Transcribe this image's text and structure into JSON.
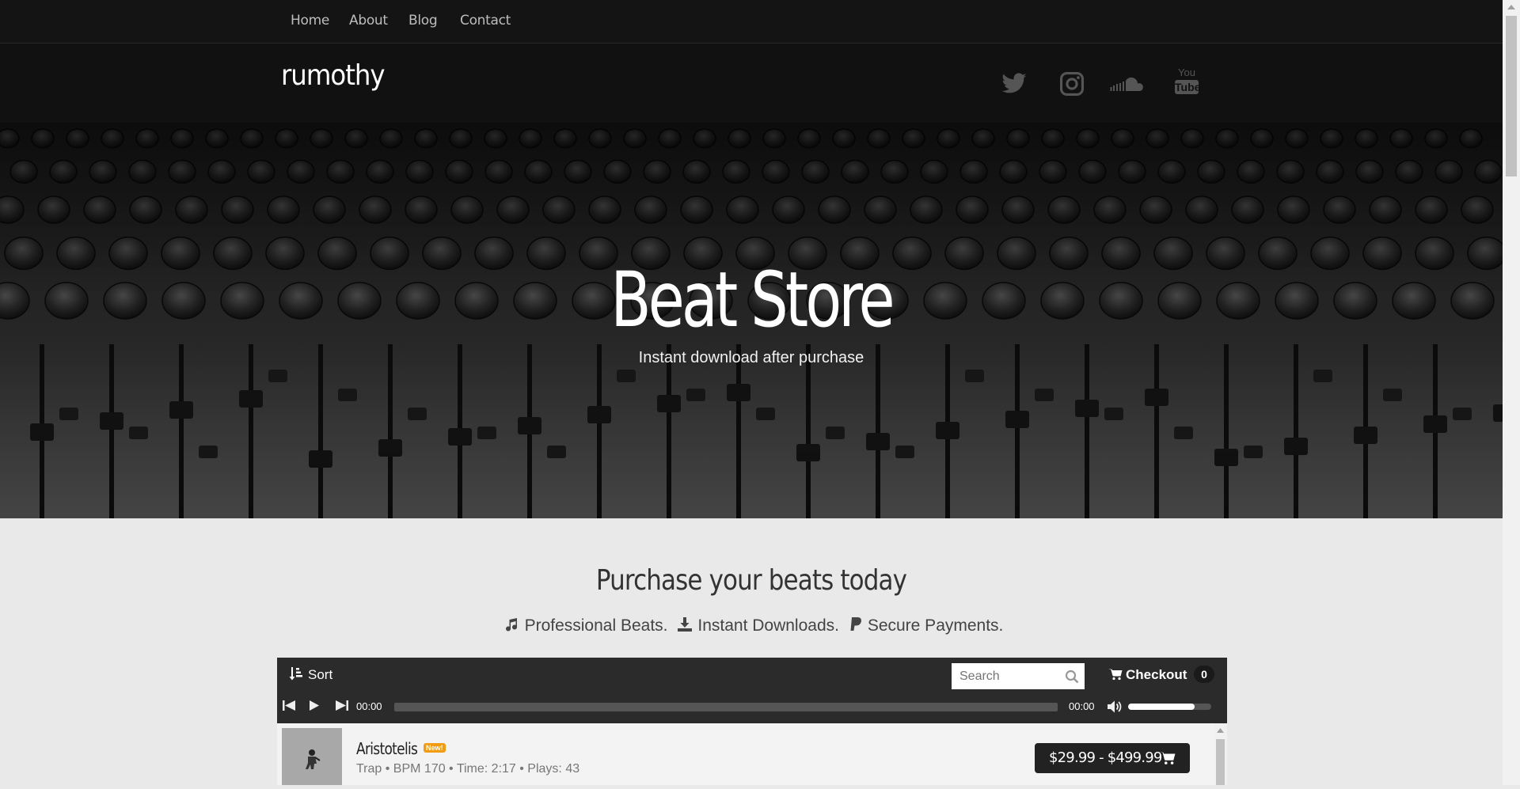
{
  "nav": {
    "items": [
      {
        "label": "Home"
      },
      {
        "label": "About"
      },
      {
        "label": "Blog"
      },
      {
        "label": "Contact"
      }
    ]
  },
  "header": {
    "brand": "rumothy",
    "social": [
      {
        "icon": "twitter-icon"
      },
      {
        "icon": "instagram-icon"
      },
      {
        "icon": "soundcloud-icon"
      },
      {
        "icon": "youtube-icon",
        "text": "You Tube"
      }
    ]
  },
  "hero": {
    "title": "Beat Store",
    "subtitle": "Instant download after purchase"
  },
  "section": {
    "title": "Purchase your beats today",
    "features": [
      {
        "icon": "music-note-icon",
        "label": "Professional Beats."
      },
      {
        "icon": "download-icon",
        "label": "Instant Downloads."
      },
      {
        "icon": "paypal-icon",
        "label": "Secure Payments."
      }
    ]
  },
  "player": {
    "sort_label": "Sort",
    "search_placeholder": "Search",
    "checkout_label": "Checkout",
    "cart_count": "0",
    "current_time": "00:00",
    "duration": "00:00",
    "progress": 0,
    "volume": 0.8
  },
  "tracks": [
    {
      "name": "Aristotelis",
      "badge": "New!",
      "meta": "Trap • BPM 170 • Time: 2:17 • Plays: 43",
      "price": "$29.99 - $499.99"
    }
  ],
  "colors": {
    "background": "#e9e9e9",
    "header": "#111111",
    "player": "#2b2b2b",
    "accent_badge": "#f39c12"
  }
}
